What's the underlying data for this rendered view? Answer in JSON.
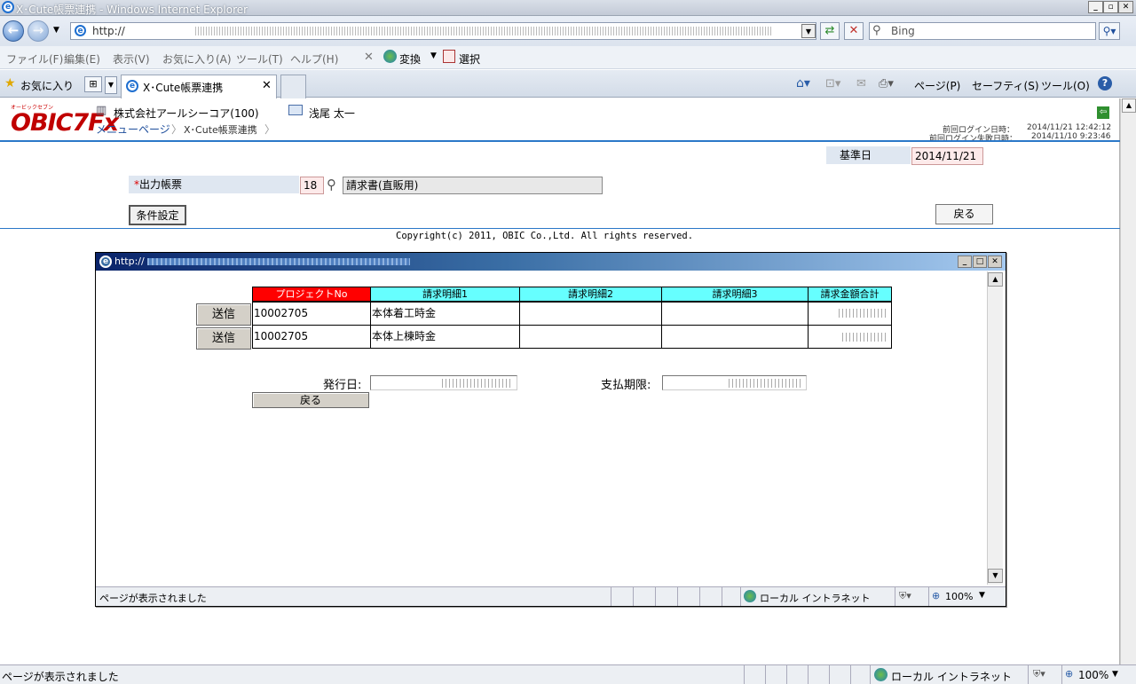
{
  "window": {
    "title": "X･Cute帳票連携 - Windows Internet Explorer"
  },
  "browser": {
    "address": "http://",
    "search_placeholder": "Bing",
    "menu": [
      "ファイル(F)",
      "編集(E)",
      "表示(V)",
      "お気に入り(A)",
      "ツール(T)",
      "ヘルプ(H)"
    ],
    "menu_extra": {
      "convert": "変換",
      "select": "選択"
    },
    "favorites": "お気に入り",
    "tab_title": "X･Cute帳票連携",
    "cmd": {
      "page": "ページ(P)",
      "safety": "セーフティ(S)",
      "tools": "ツール(O)"
    }
  },
  "app": {
    "logo": "OBIC7Fx",
    "logo_small": "オービックセブン",
    "company": "株式会社アールシーコア(100)",
    "user": "浅尾 太一",
    "breadcrumb": [
      "メニューページ",
      "X･Cute帳票連携"
    ],
    "last_login_label": "前回ログイン日時：",
    "last_login": "2014/11/21 12:42:12",
    "last_fail_label": "前回ログイン失敗日時：",
    "last_fail": "2014/11/10 9:23:46",
    "base_date_label": "基準日",
    "base_date": "2014/11/21",
    "output_label": "*出力帳票",
    "output_code": "18",
    "output_name": "請求書(直販用)",
    "cond_button": "条件設定",
    "back_button": "戻る",
    "copyright": "Copyright(c) 2011, OBIC Co.,Ltd. All rights reserved."
  },
  "popup": {
    "address": "http://",
    "columns": [
      "プロジェクトNo",
      "請求明細1",
      "請求明細2",
      "請求明細3",
      "請求金額合計"
    ],
    "send_label": "送信",
    "rows": [
      {
        "project": "10002705",
        "detail1": "本体着工時金",
        "detail2": "",
        "detail3": ""
      },
      {
        "project": "10002705",
        "detail1": "本体上棟時金",
        "detail2": "",
        "detail3": ""
      }
    ],
    "issue_label": "発行日:",
    "due_label": "支払期限:",
    "back_button": "戻る",
    "status": "ページが表示されました",
    "zone": "ローカル イントラネット",
    "zoom": "100%"
  },
  "status": {
    "text": "ページが表示されました",
    "zone": "ローカル イントラネット",
    "zoom": "100%"
  },
  "colors": {
    "header_red": "#ff0000",
    "header_cyan": "#66ffff",
    "accent_blue": "#1f6fd0"
  }
}
